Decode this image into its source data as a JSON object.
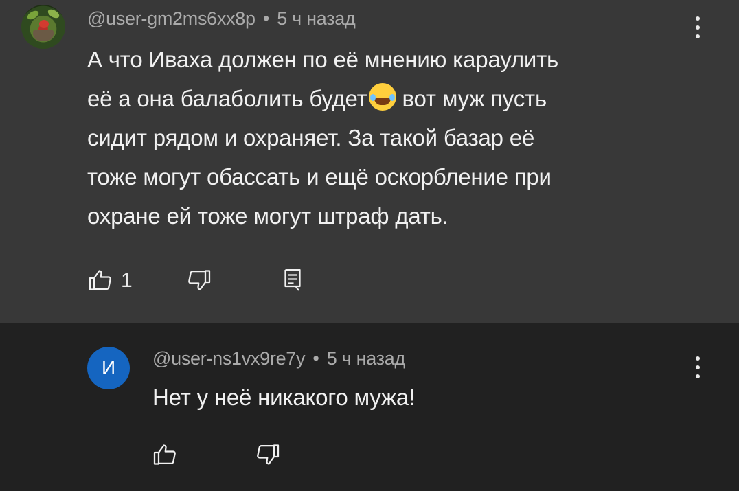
{
  "comment": {
    "author": "@user-gm2ms6xx8p",
    "separator": "•",
    "time": "5 ч назад",
    "lines": [
      "А что Иваха должен по её мнению караулить",
      "её а она балаболить будет",
      "вот муж пусть",
      "сидит рядом и охраняет. За такой базар её",
      "тоже могут обассать и ещё оскорбление при",
      "охране ей тоже могут штраф дать."
    ],
    "likes": "1",
    "emoji": "grinning-squinting-tears-emoji",
    "icons": [
      "like-icon",
      "dislike-icon",
      "reply-icon",
      "more-vert-icon"
    ]
  },
  "reply": {
    "avatar_letter": "И",
    "avatar_color": "#1565c0",
    "author": "@user-ns1vx9re7y",
    "separator": "•",
    "time": "5 ч назад",
    "text": "Нет у неё никакого мужа!",
    "icons": [
      "like-icon",
      "dislike-icon",
      "more-vert-icon"
    ]
  },
  "colors": {
    "main_bg": "#383838",
    "reply_bg": "#212121",
    "text": "#f1f1f1",
    "meta": "#aaaaaa"
  }
}
